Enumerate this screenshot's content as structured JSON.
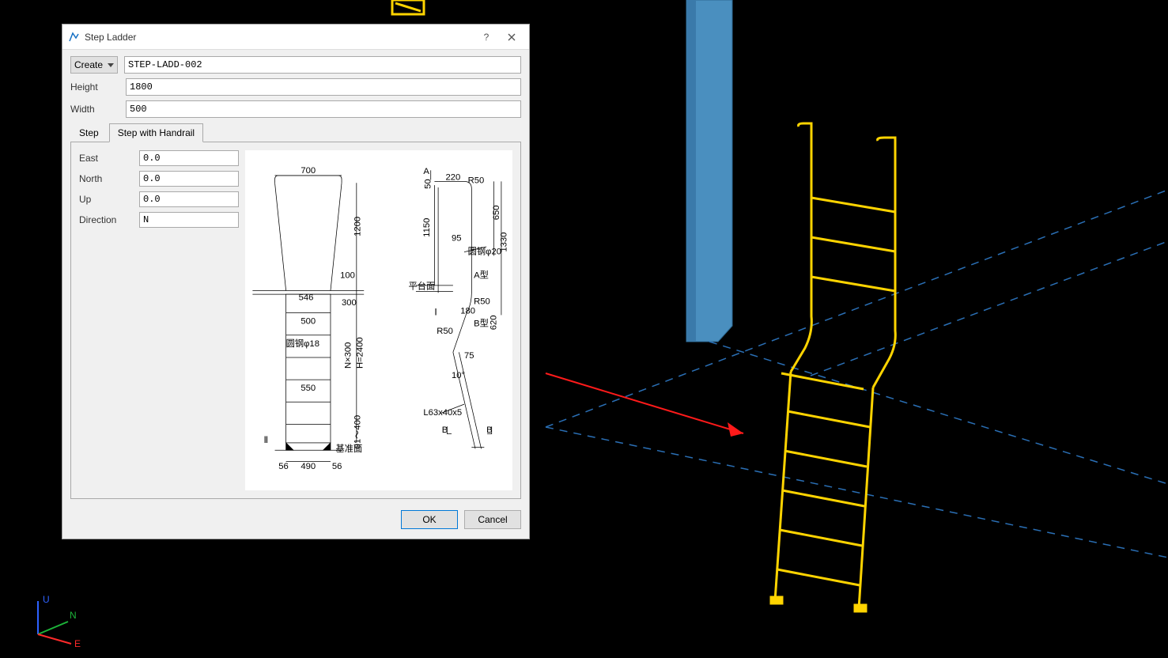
{
  "dialog": {
    "title": "Step Ladder",
    "create_label": "Create",
    "name_value": "STEP-LADD-002",
    "height_label": "Height",
    "height_value": "1800",
    "width_label": "Width",
    "width_value": "500",
    "tabs": {
      "step": "Step",
      "step_handrail": "Step with Handrail"
    },
    "east_label": "East",
    "east_value": "0.0",
    "north_label": "North",
    "north_value": "0.0",
    "up_label": "Up",
    "up_value": "0.0",
    "direction_label": "Direction",
    "direction_value": "N",
    "ok": "OK",
    "cancel": "Cancel"
  },
  "diagram": {
    "d_700": "700",
    "d_1200": "1200",
    "d_546": "546",
    "d_300": "300",
    "d_100": "100",
    "d_500": "500",
    "d_550": "550",
    "d_490": "490",
    "d_56a": "56",
    "d_56b": "56",
    "d_Nx300": "N×300",
    "d_H2400": "H=2400",
    "d_01400": "01～400",
    "d_II": "Ⅱ",
    "d_mianwu18": "圆钢φ18",
    "d_floor": "基准面",
    "a_label": "A",
    "a_down": "↓",
    "d_220": "220",
    "d_R50a": "R50",
    "d_50": "50",
    "d_1150": "1150",
    "d_95": "95",
    "d_650": "650",
    "d_1330": "1330",
    "d_mianwu20": "圆钢φ20",
    "d_Akata": "A型",
    "d_R50b": "R50",
    "d_180": "180",
    "d_620": "620",
    "d_Bkata": "B型",
    "d_R50c": "R50",
    "d_75": "75",
    "d_10d": "10°",
    "d_L63": "L63x40x5",
    "d_I": "Ⅰ",
    "d_plat": "平台面",
    "b_left": "B",
    "b_right": "B"
  },
  "ucs": {
    "u": "U",
    "n": "N",
    "e": "E"
  }
}
